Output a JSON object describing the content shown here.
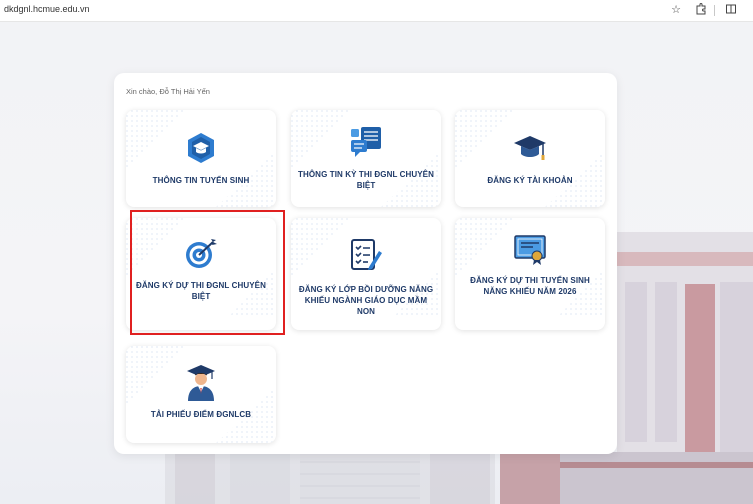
{
  "browser": {
    "url": "dkdgnl.hcmue.edu.vn"
  },
  "page": {
    "greeting": "Xin chào, Đỗ Thị Hải Yến",
    "tiles": [
      {
        "label": "THÔNG TIN TUYỂN SINH",
        "icon": "graduation-cap-badge-icon"
      },
      {
        "label": "THÔNG TIN KỲ THI ĐGNL CHUYÊN BIỆT",
        "icon": "documents-chat-icon"
      },
      {
        "label": "ĐĂNG KÝ TÀI KHOẢN",
        "icon": "mortarboard-icon"
      },
      {
        "label": "ĐĂNG KÝ DỰ THI ĐGNL CHUYÊN BIỆT",
        "icon": "target-arrow-icon"
      },
      {
        "label": "ĐĂNG KÝ LỚP BỒI DƯỠNG NĂNG KHIẾU NGÀNH GIÁO DỤC MẦM NON",
        "icon": "checklist-pencil-icon"
      },
      {
        "label": "ĐĂNG KÝ DỰ THI TUYỂN SINH NĂNG KHIẾU NĂM 2026",
        "icon": "certificate-icon"
      },
      {
        "label": "TẢI PHIẾU ĐIỂM ĐGNLCB",
        "icon": "graduate-person-icon"
      }
    ]
  },
  "colors": {
    "primary": "#1f3a68",
    "accent": "#2e7ccf",
    "highlight": "#e02020"
  }
}
